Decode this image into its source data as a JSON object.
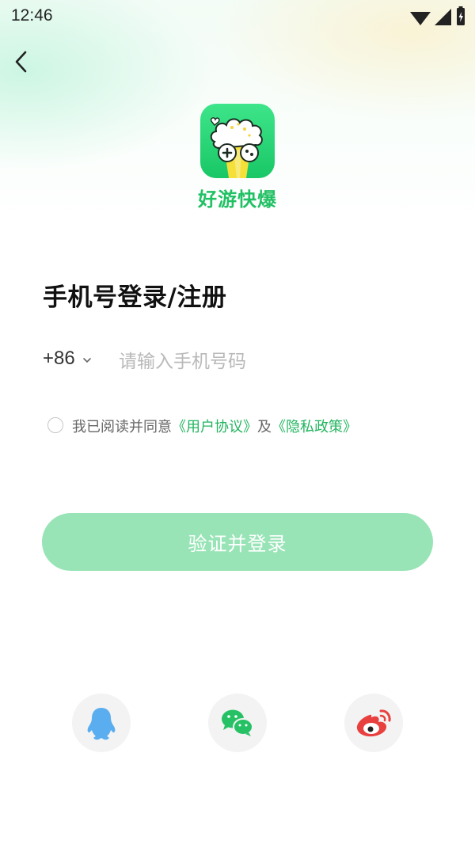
{
  "status_bar": {
    "time": "12:46"
  },
  "app": {
    "name": "好游快爆"
  },
  "page": {
    "title": "手机号登录/注册"
  },
  "phone": {
    "country_code": "+86",
    "placeholder": "请输入手机号码",
    "value": ""
  },
  "agreement": {
    "prefix": "我已阅读并同意",
    "user_agreement": "《用户协议》",
    "connector": "及",
    "privacy_policy": "《隐私政策》",
    "checked": false
  },
  "login_button": {
    "label": "验证并登录"
  },
  "social_logins": [
    {
      "name": "QQ",
      "icon": "qq-penguin-icon",
      "color": "#5aaef0"
    },
    {
      "name": "WeChat",
      "icon": "wechat-icon",
      "color": "#27c165"
    },
    {
      "name": "Weibo",
      "icon": "weibo-icon",
      "color": "#e8403f"
    }
  ],
  "colors": {
    "accent": "#22b45f",
    "button_disabled": "#98e4b6"
  }
}
